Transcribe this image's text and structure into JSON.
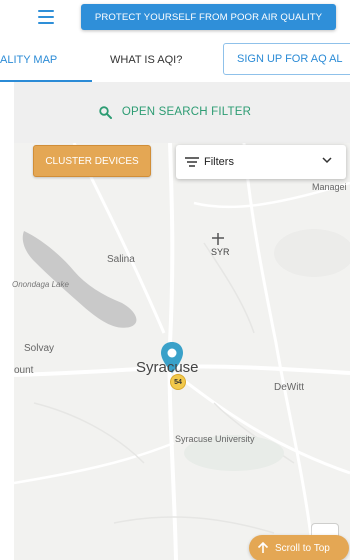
{
  "header": {
    "menu_icon": "hamburger-icon",
    "protect_label": "PROTECT YOURSELF FROM POOR AIR QUALITY"
  },
  "tabs": [
    {
      "label": "ALITY MAP",
      "active": true
    },
    {
      "label": "WHAT IS AQI?",
      "active": false
    },
    {
      "label": "SIGN UP FOR AQ AL",
      "active": false
    }
  ],
  "search": {
    "icon": "search-icon",
    "label": "OPEN SEARCH FILTER"
  },
  "map": {
    "cluster_label": "CLUSTER DEVICES",
    "filters_label": "Filters",
    "labels": {
      "manager": "Managei",
      "syr": "SYR",
      "salina": "Salina",
      "onondaga": "Onondaga Lake",
      "solvay": "Solvay",
      "ount": "ount",
      "syracuse": "Syracuse",
      "dewitt": "DeWitt",
      "syracuse_university": "Syracuse University"
    },
    "marker_value": "54"
  },
  "scroll_top_label": "Scroll to Top",
  "colors": {
    "primary": "#2f8fd9",
    "accent": "#e4a754",
    "search_green": "#2d9c73",
    "marker_teal": "#3aa1c9",
    "badge_yellow": "#f2c94c"
  }
}
